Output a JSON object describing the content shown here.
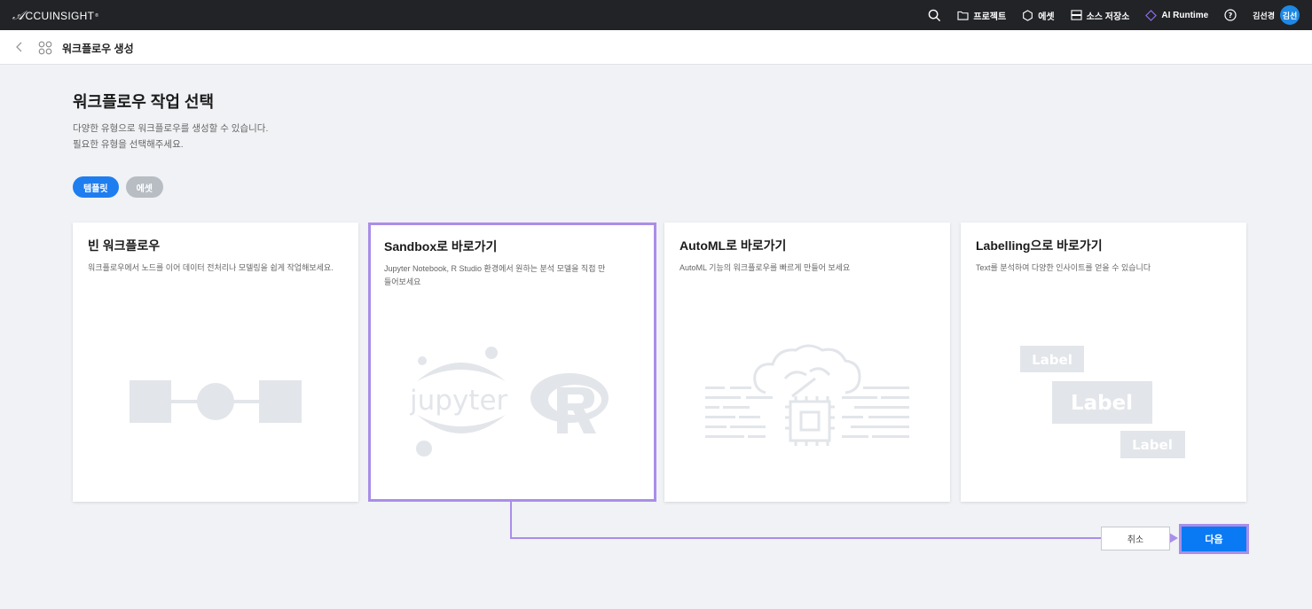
{
  "topbar": {
    "logo": "CCUINSIGHT",
    "nav": [
      {
        "label": "프로젝트",
        "icon": "folder-icon"
      },
      {
        "label": "에셋",
        "icon": "hexagon-icon"
      },
      {
        "label": "소스 저장소",
        "icon": "storage-icon"
      },
      {
        "label": "AI Runtime",
        "icon": "diamond-icon"
      }
    ],
    "user_name": "김선경",
    "avatar_text": "김선"
  },
  "subbar": {
    "title": "워크플로우 생성"
  },
  "main": {
    "title": "워크플로우 작업 선택",
    "desc_line1": "다양한 유형으로 워크플로우를 생성할 수 있습니다.",
    "desc_line2": "필요한 유형을 선택해주세요.",
    "chips": [
      {
        "label": "템플릿",
        "active": true
      },
      {
        "label": "에셋",
        "active": false
      }
    ],
    "cards": [
      {
        "title": "빈 워크플로우",
        "desc": "워크플로우에서 노드를 이어 데이터 전처리나 모델링을 쉽게 작업해보세요."
      },
      {
        "title": "Sandbox로 바로가기",
        "desc": "Jupyter Notebook, R Studio 환경에서 원하는 분석 모델을 직접 만들어보세요",
        "illustration_text": "jupyter"
      },
      {
        "title": "AutoML로 바로가기",
        "desc": "AutoML 기능의 워크플로우를 빠르게 만들어 보세요"
      },
      {
        "title": "Labelling으로 바로가기",
        "desc": "Text를 분석하여 다양한 인사이트를 얻을 수 있습니다",
        "labels": [
          "Label",
          "Label",
          "Label"
        ]
      }
    ],
    "selected_card": 1
  },
  "footer": {
    "cancel_label": "취소",
    "next_label": "다음"
  },
  "colors": {
    "accent": "#0a7af4",
    "highlight": "#a98ee8",
    "topbar": "#212326"
  }
}
